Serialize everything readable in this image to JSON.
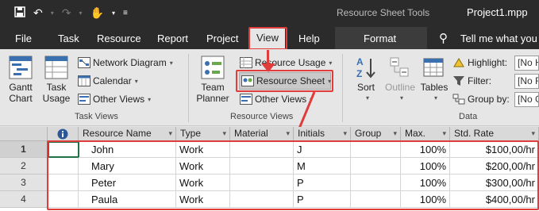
{
  "titlebar": {
    "context_title": "Resource Sheet Tools",
    "document_title": "Project1.mpp"
  },
  "tabs": [
    {
      "label": "File"
    },
    {
      "label": "Task"
    },
    {
      "label": "Resource"
    },
    {
      "label": "Report"
    },
    {
      "label": "Project"
    },
    {
      "label": "View",
      "selected": true
    },
    {
      "label": "Help"
    },
    {
      "label": "Format"
    }
  ],
  "tell_me": "Tell me what you w",
  "ribbon": {
    "task_views": {
      "label": "Task Views",
      "gantt": "Gantt",
      "gantt2": "Chart",
      "usage": "Task",
      "usage2": "Usage",
      "network": "Network Diagram",
      "calendar": "Calendar",
      "other": "Other Views"
    },
    "resource_views": {
      "label": "Resource Views",
      "team": "Team",
      "team2": "Planner",
      "res_usage": "Resource Usage",
      "res_sheet": "Resource Sheet",
      "other": "Other Views"
    },
    "data": {
      "label": "Data",
      "sort": "Sort",
      "outline": "Outline",
      "tables": "Tables",
      "highlight_label": "Highlight:",
      "highlight_value": "[No H",
      "filter_label": "Filter:",
      "filter_value": "[No F",
      "groupby_label": "Group by:",
      "groupby_value": "[No G"
    }
  },
  "grid": {
    "columns": [
      "Resource Name",
      "Type",
      "Material",
      "Initials",
      "Group",
      "Max.",
      "Std. Rate"
    ],
    "rows": [
      {
        "num": "1",
        "name": "John",
        "type": "Work",
        "material": "",
        "initials": "J",
        "group": "",
        "max": "100%",
        "rate": "$100,00/hr"
      },
      {
        "num": "2",
        "name": "Mary",
        "type": "Work",
        "material": "",
        "initials": "M",
        "group": "",
        "max": "100%",
        "rate": "$200,00/hr"
      },
      {
        "num": "3",
        "name": "Peter",
        "type": "Work",
        "material": "",
        "initials": "P",
        "group": "",
        "max": "100%",
        "rate": "$300,00/hr"
      },
      {
        "num": "4",
        "name": "Paula",
        "type": "Work",
        "material": "",
        "initials": "P",
        "group": "",
        "max": "100%",
        "rate": "$400,00/hr"
      }
    ]
  },
  "colors": {
    "annotation": "#e03c3c",
    "titlebar": "#2b2b2b",
    "ribbon": "#e6e6e6",
    "selection": "#217346"
  }
}
